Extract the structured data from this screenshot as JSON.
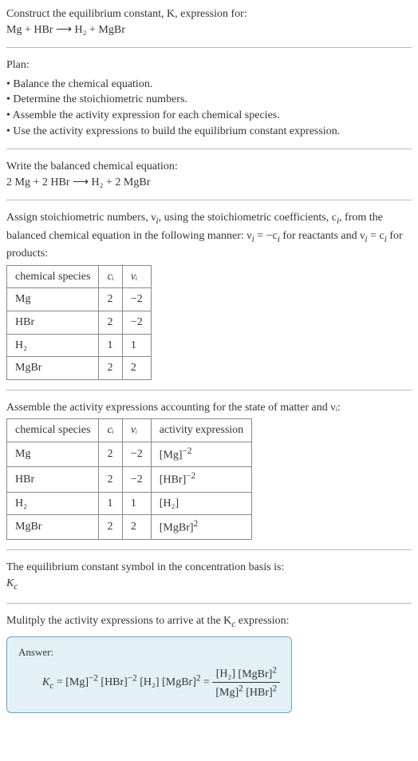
{
  "intro": {
    "line1": "Construct the equilibrium constant, K, expression for:",
    "equation": "Mg + HBr ⟶ H₂ + MgBr"
  },
  "plan": {
    "heading": "Plan:",
    "items": [
      "Balance the chemical equation.",
      "Determine the stoichiometric numbers.",
      "Assemble the activity expression for each chemical species.",
      "Use the activity expressions to build the equilibrium constant expression."
    ]
  },
  "balanced": {
    "heading": "Write the balanced chemical equation:",
    "equation": "2 Mg + 2 HBr ⟶ H₂ + 2 MgBr"
  },
  "assign": {
    "text_parts": {
      "p1": "Assign stoichiometric numbers, ν",
      "p2": ", using the stoichiometric coefficients, c",
      "p3": ", from the balanced chemical equation in the following manner: ν",
      "p4": " = −c",
      "p5": " for reactants and ν",
      "p6": " = c",
      "p7": " for products:"
    },
    "headers": {
      "species": "chemical species",
      "c": "cᵢ",
      "v": "νᵢ"
    },
    "rows": [
      {
        "species": "Mg",
        "c": "2",
        "v": "−2"
      },
      {
        "species": "HBr",
        "c": "2",
        "v": "−2"
      },
      {
        "species": "H₂",
        "c": "1",
        "v": "1"
      },
      {
        "species": "MgBr",
        "c": "2",
        "v": "2"
      }
    ]
  },
  "activity": {
    "heading": "Assemble the activity expressions accounting for the state of matter and νᵢ:",
    "headers": {
      "species": "chemical species",
      "c": "cᵢ",
      "v": "νᵢ",
      "act": "activity expression"
    },
    "rows": [
      {
        "species": "Mg",
        "c": "2",
        "v": "−2",
        "base": "[Mg]",
        "exp": "−2"
      },
      {
        "species": "HBr",
        "c": "2",
        "v": "−2",
        "base": "[HBr]",
        "exp": "−2"
      },
      {
        "species": "H₂",
        "c": "1",
        "v": "1",
        "base": "[H₂]",
        "exp": ""
      },
      {
        "species": "MgBr",
        "c": "2",
        "v": "2",
        "base": "[MgBr]",
        "exp": "2"
      }
    ]
  },
  "symbol": {
    "line1": "The equilibrium constant symbol in the concentration basis is:",
    "k": "K",
    "ksub": "c"
  },
  "multiply": {
    "text_parts": {
      "p1": "Mulitply the activity expressions to arrive at the K",
      "p2": " expression:"
    }
  },
  "answer": {
    "label": "Answer:",
    "k": "K",
    "ksub": "c",
    "lhs_terms": [
      {
        "base": "[Mg]",
        "exp": "−2"
      },
      {
        "base": "[HBr]",
        "exp": "−2"
      },
      {
        "base": "[H₂]",
        "exp": ""
      },
      {
        "base": "[MgBr]",
        "exp": "2"
      }
    ],
    "num_terms": [
      {
        "base": "[H₂]",
        "exp": ""
      },
      {
        "base": "[MgBr]",
        "exp": "2"
      }
    ],
    "den_terms": [
      {
        "base": "[Mg]",
        "exp": "2"
      },
      {
        "base": "[HBr]",
        "exp": "2"
      }
    ]
  }
}
